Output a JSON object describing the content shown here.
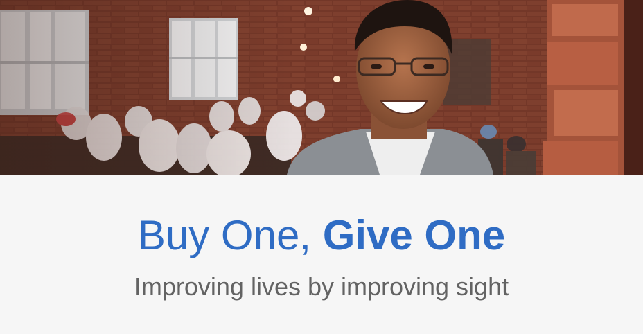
{
  "headline": {
    "prefix": "Buy One, ",
    "emphasis": "Give One"
  },
  "subheadline": "Improving lives by improving sight",
  "colors": {
    "headline": "#2f6cc4",
    "subheadline": "#636363",
    "caption_background": "#f6f6f6"
  }
}
